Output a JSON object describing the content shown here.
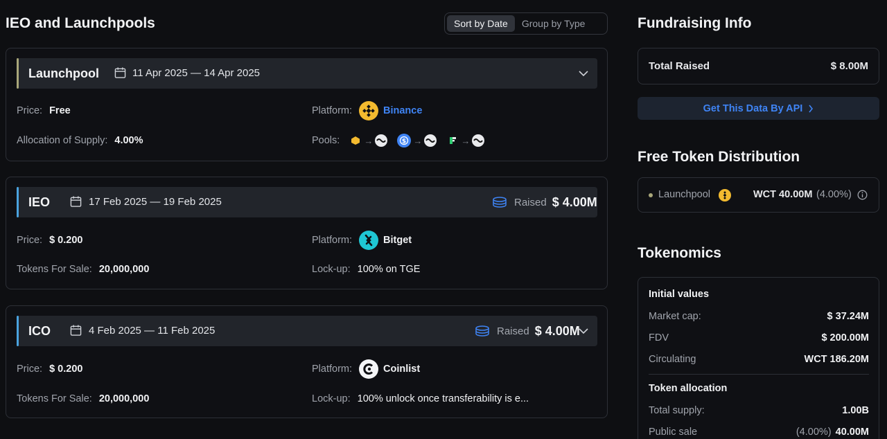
{
  "left": {
    "title": "IEO and Launchpools",
    "sort_options": [
      "Sort by Date",
      "Group by Type"
    ],
    "cards": [
      {
        "type": "Launchpool",
        "dates": "11 Apr 2025 — 14 Apr 2025",
        "accent": "#a9a77a",
        "price_label": "Price:",
        "price": "Free",
        "platform_label": "Platform:",
        "platform": "Binance",
        "supply_label": "Allocation of Supply:",
        "supply": "4.00%",
        "pools_label": "Pools:"
      },
      {
        "type": "IEO",
        "dates": "17 Feb 2025 — 19 Feb 2025",
        "accent": "#4aa3df",
        "raised_label": "Raised",
        "raised": "$ 4.00M",
        "price_label": "Price:",
        "price": "$ 0.200",
        "platform_label": "Platform:",
        "platform": "Bitget",
        "tokens_label": "Tokens For Sale:",
        "tokens": "20,000,000",
        "lock_label": "Lock-up:",
        "lock": "100% on TGE"
      },
      {
        "type": "ICO",
        "dates": "4 Feb 2025 — 11 Feb 2025",
        "accent": "#4aa3df",
        "raised_label": "Raised",
        "raised": "$ 4.00M",
        "price_label": "Price:",
        "price": "$ 0.200",
        "platform_label": "Platform:",
        "platform": "Coinlist",
        "tokens_label": "Tokens For Sale:",
        "tokens": "20,000,000",
        "lock_label": "Lock-up:",
        "lock": "100% unlock once transferability is e..."
      }
    ]
  },
  "right": {
    "fundraising_title": "Fundraising Info",
    "total_raised_label": "Total Raised",
    "total_raised": "$ 8.00M",
    "api_button": "Get This Data By API",
    "distribution_title": "Free Token Distribution",
    "distribution": {
      "label": "Launchpool",
      "value": "WCT 40.00M",
      "pct": "(4.00%)"
    },
    "tokenomics_title": "Tokenomics",
    "initial_title": "Initial values",
    "initial": [
      {
        "k": "Market cap:",
        "v": "$ 37.24M"
      },
      {
        "k": "FDV",
        "v": "$ 200.00M"
      },
      {
        "k": "Circulating",
        "v": "WCT 186.20M"
      }
    ],
    "allocation_title": "Token allocation",
    "total_supply_label": "Total supply:",
    "total_supply": "1.00B",
    "public_sale_label": "Public sale",
    "public_sale_pct": "(4.00%)",
    "public_sale": "40.00M"
  },
  "colors": {
    "binance": "#f3ba2f",
    "bitget": "#1fc7d4",
    "link": "#3f84f5"
  }
}
